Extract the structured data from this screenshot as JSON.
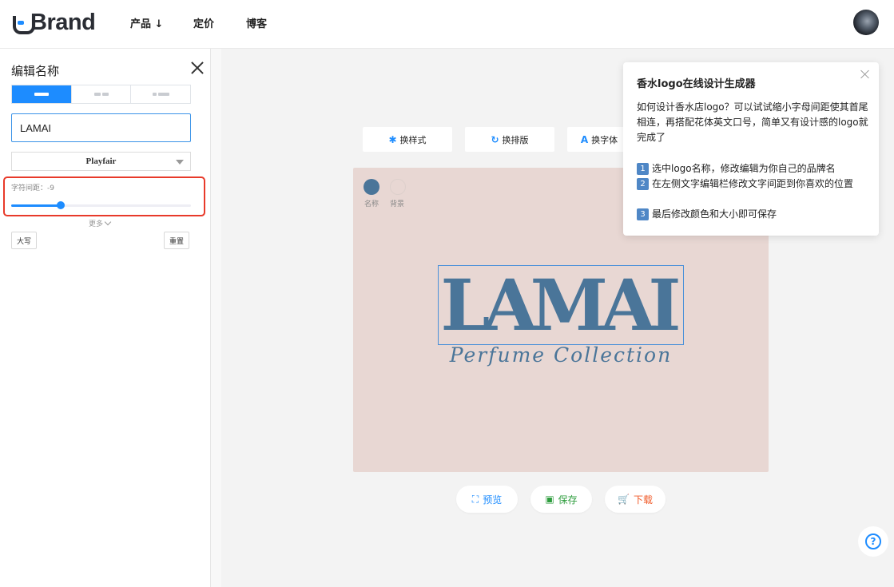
{
  "brand": {
    "name": "Brand"
  },
  "nav": {
    "items": [
      "产品 ↓",
      "定价",
      "博客"
    ]
  },
  "editor": {
    "title": "编辑名称",
    "name_value": "LAMAI",
    "name_placeholder": "",
    "font_name": "Playfair",
    "letter_spacing_label": "字符间距：-9",
    "letter_spacing_value": -9,
    "slider_fraction": 0.27,
    "more_label": "更多",
    "uppercase_label": "大写",
    "reset_label": "重置"
  },
  "toolbar": {
    "change_style": "换样式",
    "change_layout": "换排版",
    "change_font": "换字体"
  },
  "canvas": {
    "swatch_name_label": "名称",
    "swatch_bg_label": "背景",
    "logo_name": "LAMAI",
    "slogan": "Perfume Collection",
    "colors": {
      "name": "#4a7599",
      "background": "#e8d7d3"
    }
  },
  "actions": {
    "preview": "预览",
    "save": "保存",
    "download": "下载"
  },
  "tip": {
    "title": "香水logo在线设计生成器",
    "intro": "如何设计香水店logo？可以试试缩小字母间距使其首尾相连，再搭配花体英文口号，简单又有设计感的logo就完成了",
    "steps": [
      {
        "num": "1",
        "text": "选中logo名称，修改编辑为你自己的品牌名"
      },
      {
        "num": "2",
        "text": "在左侧文字编辑栏修改文字间距到你喜欢的位置"
      },
      {
        "num": "3",
        "text": "最后修改颜色和大小即可保存"
      }
    ]
  },
  "theme": {
    "accent": "#1d8cff",
    "highlight": "#e83a2a",
    "save_green": "#2e9d3e",
    "download_orange": "#f05a28"
  }
}
